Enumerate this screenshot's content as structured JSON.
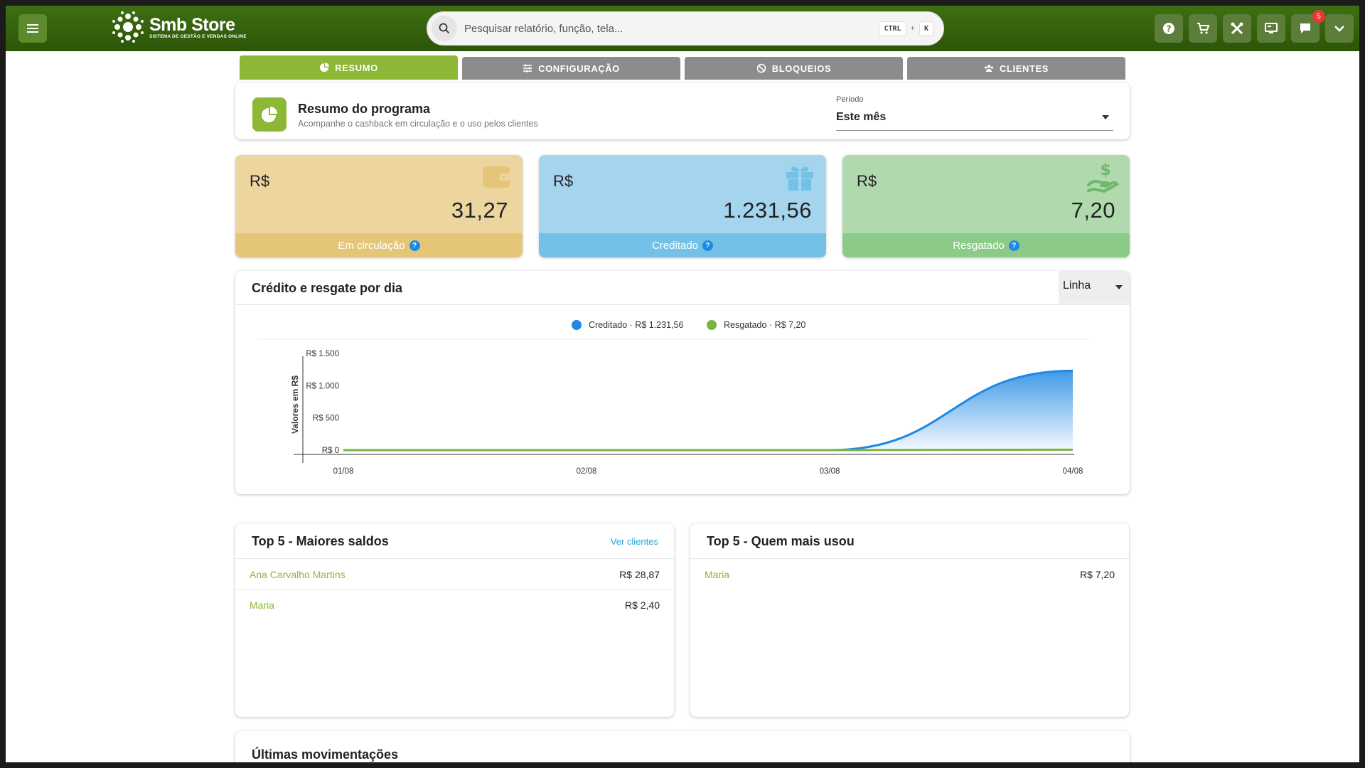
{
  "header": {
    "brand_name": "Smb Store",
    "brand_tagline": "SISTEMA DE GESTÃO E VENDAS ONLINE",
    "search_placeholder": "Pesquisar relatório, função, tela...",
    "shortcut_key1": "CTRL",
    "shortcut_plus": "+",
    "shortcut_key2": "K",
    "notification_count": "5",
    "accent_color": "#3f6f12"
  },
  "tabs": [
    {
      "label": "RESUMO",
      "icon": "pie-chart-icon"
    },
    {
      "label": "CONFIGURAÇÃO",
      "icon": "sliders-icon"
    },
    {
      "label": "BLOQUEIOS",
      "icon": "ban-icon"
    },
    {
      "label": "CLIENTES",
      "icon": "users-icon"
    }
  ],
  "summary": {
    "title": "Resumo do programa",
    "subtitle": "Acompanhe o cashback em circulação e o uso pelos clientes",
    "period_label": "Período",
    "period_value": "Este mês"
  },
  "stats": [
    {
      "currency": "R$",
      "value": "31,27",
      "label": "Em circulação",
      "icon": "wallet-icon",
      "color": "#e5c679"
    },
    {
      "currency": "R$",
      "value": "1.231,56",
      "label": "Creditado",
      "icon": "gift-icon",
      "color": "#74c1e8"
    },
    {
      "currency": "R$",
      "value": "7,20",
      "label": "Resgatado",
      "icon": "hand-money-icon",
      "color": "#8ccb87"
    }
  ],
  "help_glyph": "?",
  "chart": {
    "title": "Crédito e resgate por dia",
    "type_select": "Linha"
  },
  "chart_data": {
    "type": "area",
    "ylabel": "Valores em R$",
    "y_ticks": [
      "R$ 0",
      "R$ 500",
      "R$ 1.000",
      "R$ 1.500"
    ],
    "ylim": [
      0,
      1500
    ],
    "x": [
      "01/08",
      "02/08",
      "03/08",
      "04/08"
    ],
    "legend_position": "top-center",
    "series": [
      {
        "name": "Creditado · R$ 1.231,56",
        "values": [
          0,
          0,
          0,
          1231.56
        ],
        "color": "#1e88e5"
      },
      {
        "name": "Resgatado · R$ 7,20",
        "values": [
          0,
          0,
          0,
          7.2
        ],
        "color": "#7cb342"
      }
    ]
  },
  "top_balances": {
    "title": "Top 5 - Maiores saldos",
    "link": "Ver clientes",
    "rows": [
      {
        "name": "Ana Carvalho Martins",
        "value": "R$ 28,87"
      },
      {
        "name": "Maria",
        "value": "R$ 2,40"
      }
    ]
  },
  "top_usage": {
    "title": "Top 5 - Quem mais usou",
    "rows": [
      {
        "name": "Maria",
        "value": "R$ 7,20"
      }
    ]
  },
  "movements": {
    "title": "Últimas movimentações"
  }
}
